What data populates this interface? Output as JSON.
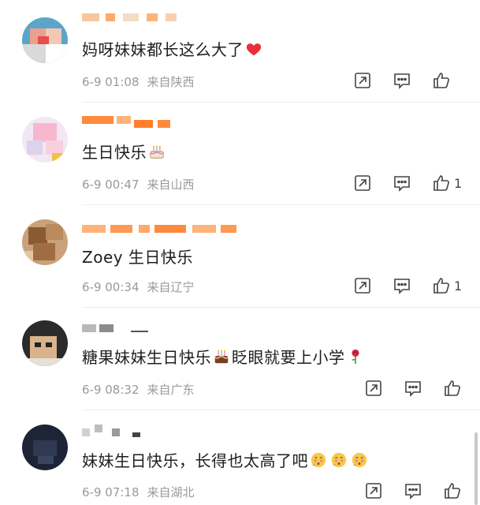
{
  "comments": [
    {
      "text": "妈呀妹妹都长这么大了",
      "emoji_after": "heart-icon",
      "date": "6-9 01:08",
      "location": "来自陕西",
      "likes": "",
      "usernames_hidden": true
    },
    {
      "text": "生日快乐",
      "emoji_after": "cake-icon",
      "date": "6-9 00:47",
      "location": "来自山西",
      "likes": "1"
    },
    {
      "text": "Zoey 生日快乐",
      "date": "6-9 00:34",
      "location": "来自辽宁",
      "likes": "1"
    },
    {
      "text_a": "糖果妹妹生日快乐",
      "text_b": "眨眼就要上小学",
      "date": "6-9 08:32",
      "location": "来自广东",
      "likes": ""
    },
    {
      "text": "妹妹生日快乐，长得也太高了吧",
      "date": "6-9 07:18",
      "location": "来自湖北",
      "likes": ""
    }
  ],
  "icons": {
    "share": "share-icon",
    "comment": "comment-icon",
    "like": "thumbs-up-icon"
  },
  "colors": {
    "heart": "#e8303a",
    "meta": "#9a9a9a",
    "text": "#1e1e1e",
    "name_blur": "#ff8a3d"
  }
}
